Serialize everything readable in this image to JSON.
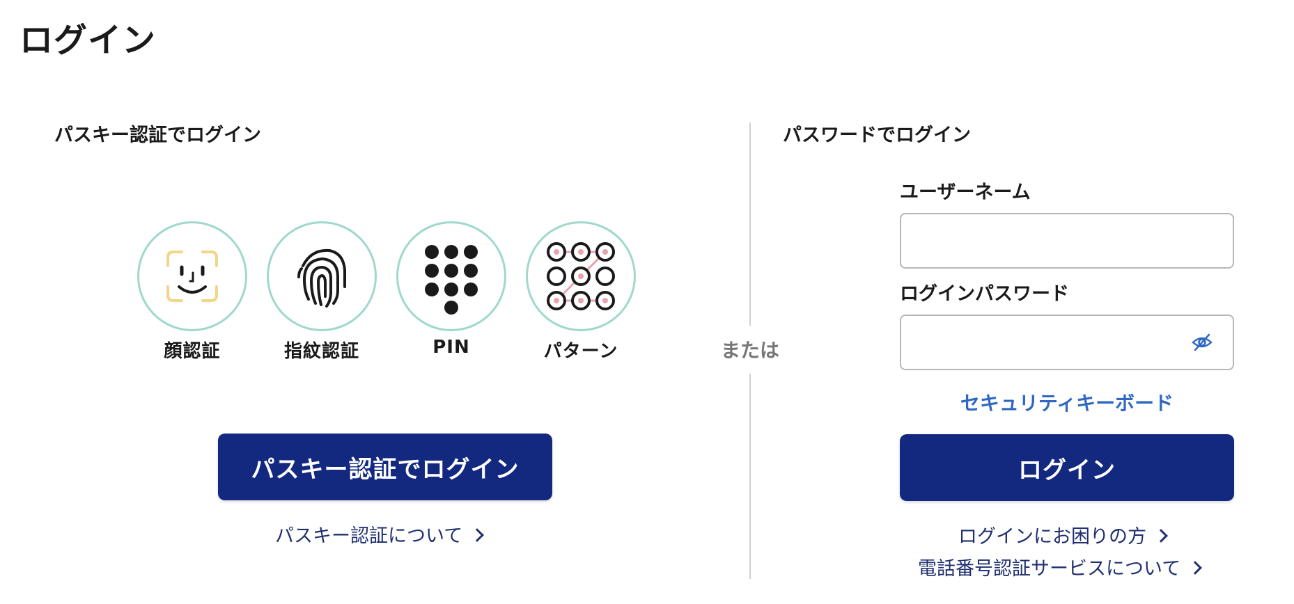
{
  "page_title": "ログイン",
  "divider_label": "または",
  "passkey_section": {
    "title": "パスキー認証でログイン",
    "methods": [
      {
        "label": "顔認証",
        "icon": "face-icon"
      },
      {
        "label": "指紋認証",
        "icon": "fingerprint-icon"
      },
      {
        "label": "PIN",
        "icon": "pin-keypad-icon"
      },
      {
        "label": "パターン",
        "icon": "pattern-icon"
      }
    ],
    "button_label": "パスキー認証でログイン",
    "about_link": "パスキー認証について"
  },
  "password_section": {
    "title": "パスワードでログイン",
    "username_label": "ユーザーネーム",
    "username_value": "",
    "password_label": "ログインパスワード",
    "password_value": "",
    "security_keyboard_link": "セキュリティキーボード",
    "button_label": "ログイン",
    "help_link": "ログインにお困りの方",
    "phone_auth_link": "電話番号認証サービスについて"
  },
  "colors": {
    "primary": "#13297f",
    "link": "#1f2f6f",
    "accent_link": "#2f68c2",
    "circle_border": "#9fd8cc",
    "face_corner": "#f2d588",
    "pattern_line": "#e8a3ad"
  }
}
